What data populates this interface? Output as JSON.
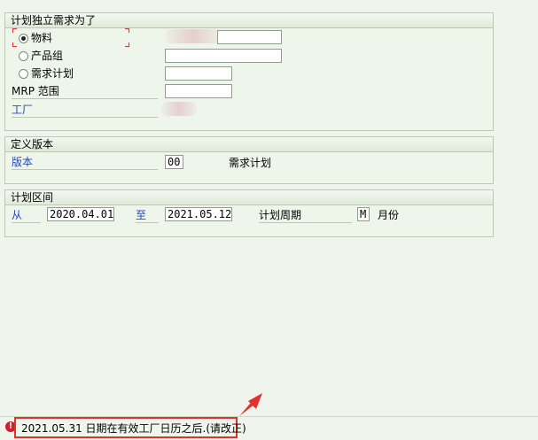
{
  "group1": {
    "title": "计划独立需求为了",
    "radio_material": "物料",
    "radio_product_group": "产品组",
    "radio_requirements_plan": "需求计划",
    "mrp_area_label": "MRP 范围",
    "plant_label": "工厂"
  },
  "group2": {
    "title": "定义版本",
    "version_label": "版本",
    "version_value": "00",
    "version_desc": "需求计划"
  },
  "group3": {
    "title": "计划区间",
    "from_label": "从",
    "from_value": "2020.04.01",
    "to_label": "至",
    "to_value": "2021.05.12",
    "period_label": "计划周期",
    "period_value": "M",
    "period_desc": "月份"
  },
  "status": {
    "icon": "error-icon",
    "icon_glyph": "!",
    "message": "2021.05.31 日期在有效工厂日历之后.(请改正)"
  },
  "colors": {
    "background": "#eff5ec",
    "link": "#2049c8",
    "highlight": "#e0322f",
    "error": "#c8232a"
  }
}
